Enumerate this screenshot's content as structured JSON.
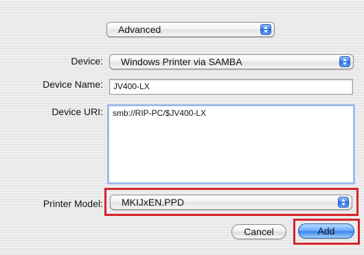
{
  "mode_popup": {
    "value": "Advanced"
  },
  "device": {
    "label": "Device:",
    "value": "Windows Printer via SAMBA"
  },
  "device_name": {
    "label": "Device Name:",
    "value": "JV400-LX"
  },
  "device_uri": {
    "label": "Device URI:",
    "value": "smb://RIP-PC/$JV400-LX"
  },
  "printer_model": {
    "label": "Printer Model:",
    "value": "MKIJxEN.PPD"
  },
  "buttons": {
    "cancel": "Cancel",
    "add": "Add"
  },
  "colors": {
    "highlight": "#d6232a",
    "accent": "#3d86f0"
  },
  "icons": {
    "popup_arrows": "up-down-arrows-icon"
  }
}
